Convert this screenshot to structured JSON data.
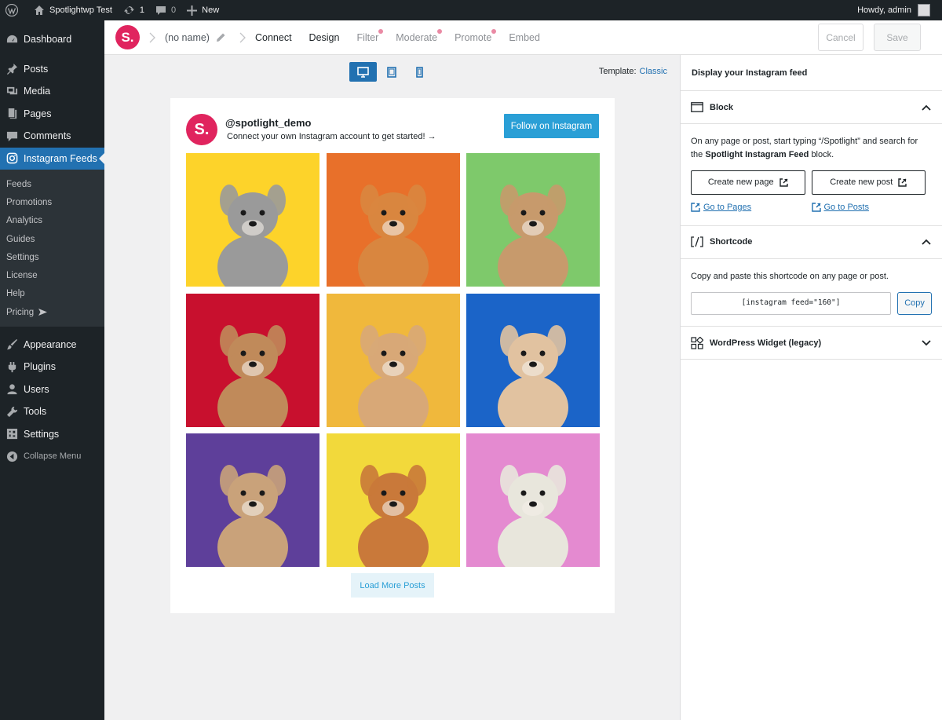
{
  "admin_bar": {
    "site_name": "Spotlightwp Test",
    "updates_count": "1",
    "comments_count": "0",
    "new_label": "New",
    "greeting": "Howdy, admin"
  },
  "sidebar": {
    "items_top": [
      {
        "label": "Dashboard",
        "icon": "dashboard-icon"
      },
      {
        "label": "Posts",
        "icon": "pin-icon"
      },
      {
        "label": "Media",
        "icon": "media-icon"
      },
      {
        "label": "Pages",
        "icon": "pages-icon"
      },
      {
        "label": "Comments",
        "icon": "comment-icon"
      }
    ],
    "active_item": {
      "label": "Instagram Feeds",
      "icon": "instagram-icon"
    },
    "submenu": [
      "Feeds",
      "Promotions",
      "Analytics",
      "Guides",
      "Settings",
      "License",
      "Help",
      "Pricing"
    ],
    "items_bottom": [
      {
        "label": "Appearance",
        "icon": "brush-icon"
      },
      {
        "label": "Plugins",
        "icon": "plugin-icon"
      },
      {
        "label": "Users",
        "icon": "users-icon"
      },
      {
        "label": "Tools",
        "icon": "wrench-icon"
      },
      {
        "label": "Settings",
        "icon": "settings-icon"
      }
    ],
    "collapse_label": "Collapse Menu"
  },
  "toolbar": {
    "logo_text": "S.",
    "feed_name": "(no name)",
    "tabs": [
      "Connect",
      "Design",
      "Filter",
      "Moderate",
      "Promote",
      "Embed"
    ],
    "cancel_label": "Cancel",
    "save_label": "Save"
  },
  "preview": {
    "template_label": "Template:",
    "template_value": "Classic",
    "username": "@spotlight_demo",
    "bio": "Connect your own Instagram account to get started! →",
    "follow_label": "Follow on Instagram",
    "avatar_text": "S.",
    "load_more_label": "Load More Posts",
    "tile_colors": [
      "#fdd32a",
      "#e8702a",
      "#7ec96b",
      "#c8102e",
      "#f0b83c",
      "#1b64c8",
      "#5e3f9a",
      "#f2d93b",
      "#e48ad0"
    ],
    "tile_dog_colors": [
      "#9a9a9a",
      "#d9863f",
      "#c79a6c",
      "#c08a5a",
      "#d8a877",
      "#e1c2a0",
      "#c9a27a",
      "#c9793a",
      "#e8e6dc"
    ]
  },
  "panel": {
    "title": "Display your Instagram feed",
    "block": {
      "heading": "Block",
      "description_pre": "On any page or post, start typing “/Spotlight” and search for the",
      "description_bold": "Spotlight Instagram Feed",
      "description_post": "block.",
      "create_page": "Create new page",
      "create_post": "Create new post",
      "go_pages": "Go to Pages",
      "go_posts": "Go to Posts"
    },
    "shortcode": {
      "heading": "Shortcode",
      "description": "Copy and paste this shortcode on any page or post.",
      "code": "[instagram feed=\"160\"]",
      "copy_label": "Copy"
    },
    "widget": {
      "heading": "WordPress Widget (legacy)"
    }
  }
}
